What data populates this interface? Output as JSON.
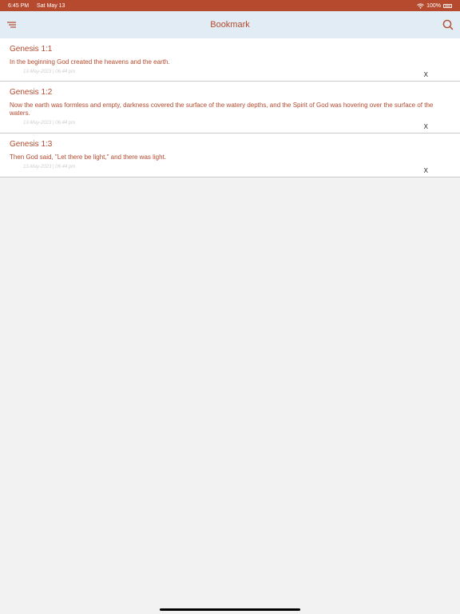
{
  "status_bar": {
    "time": "6:45 PM",
    "date": "Sat May 13",
    "battery": "100%"
  },
  "header": {
    "title": "Bookmark",
    "menu_icon": "menu-icon",
    "search_icon": "search-icon"
  },
  "bookmarks": [
    {
      "reference": "Genesis 1:1",
      "text": "In the beginning God created the heavens and the earth.",
      "timestamp": "13-May-2023 | 06:44 pm",
      "delete_label": "X"
    },
    {
      "reference": "Genesis 1:2",
      "text": "Now the earth was formless and empty, darkness covered the surface of the watery depths, and the Spirit of God was hovering over the surface of the waters.",
      "timestamp": "13-May-2023 | 06:44 pm",
      "delete_label": "X"
    },
    {
      "reference": "Genesis 1:3",
      "text": "Then God said, \"Let there be light,\" and there was light.",
      "timestamp": "13-May-2023 | 06:44 pm",
      "delete_label": "X"
    }
  ],
  "colors": {
    "accent": "#b54a2e",
    "header_bg": "#e1ecf4",
    "page_bg": "#f2f2f2"
  }
}
